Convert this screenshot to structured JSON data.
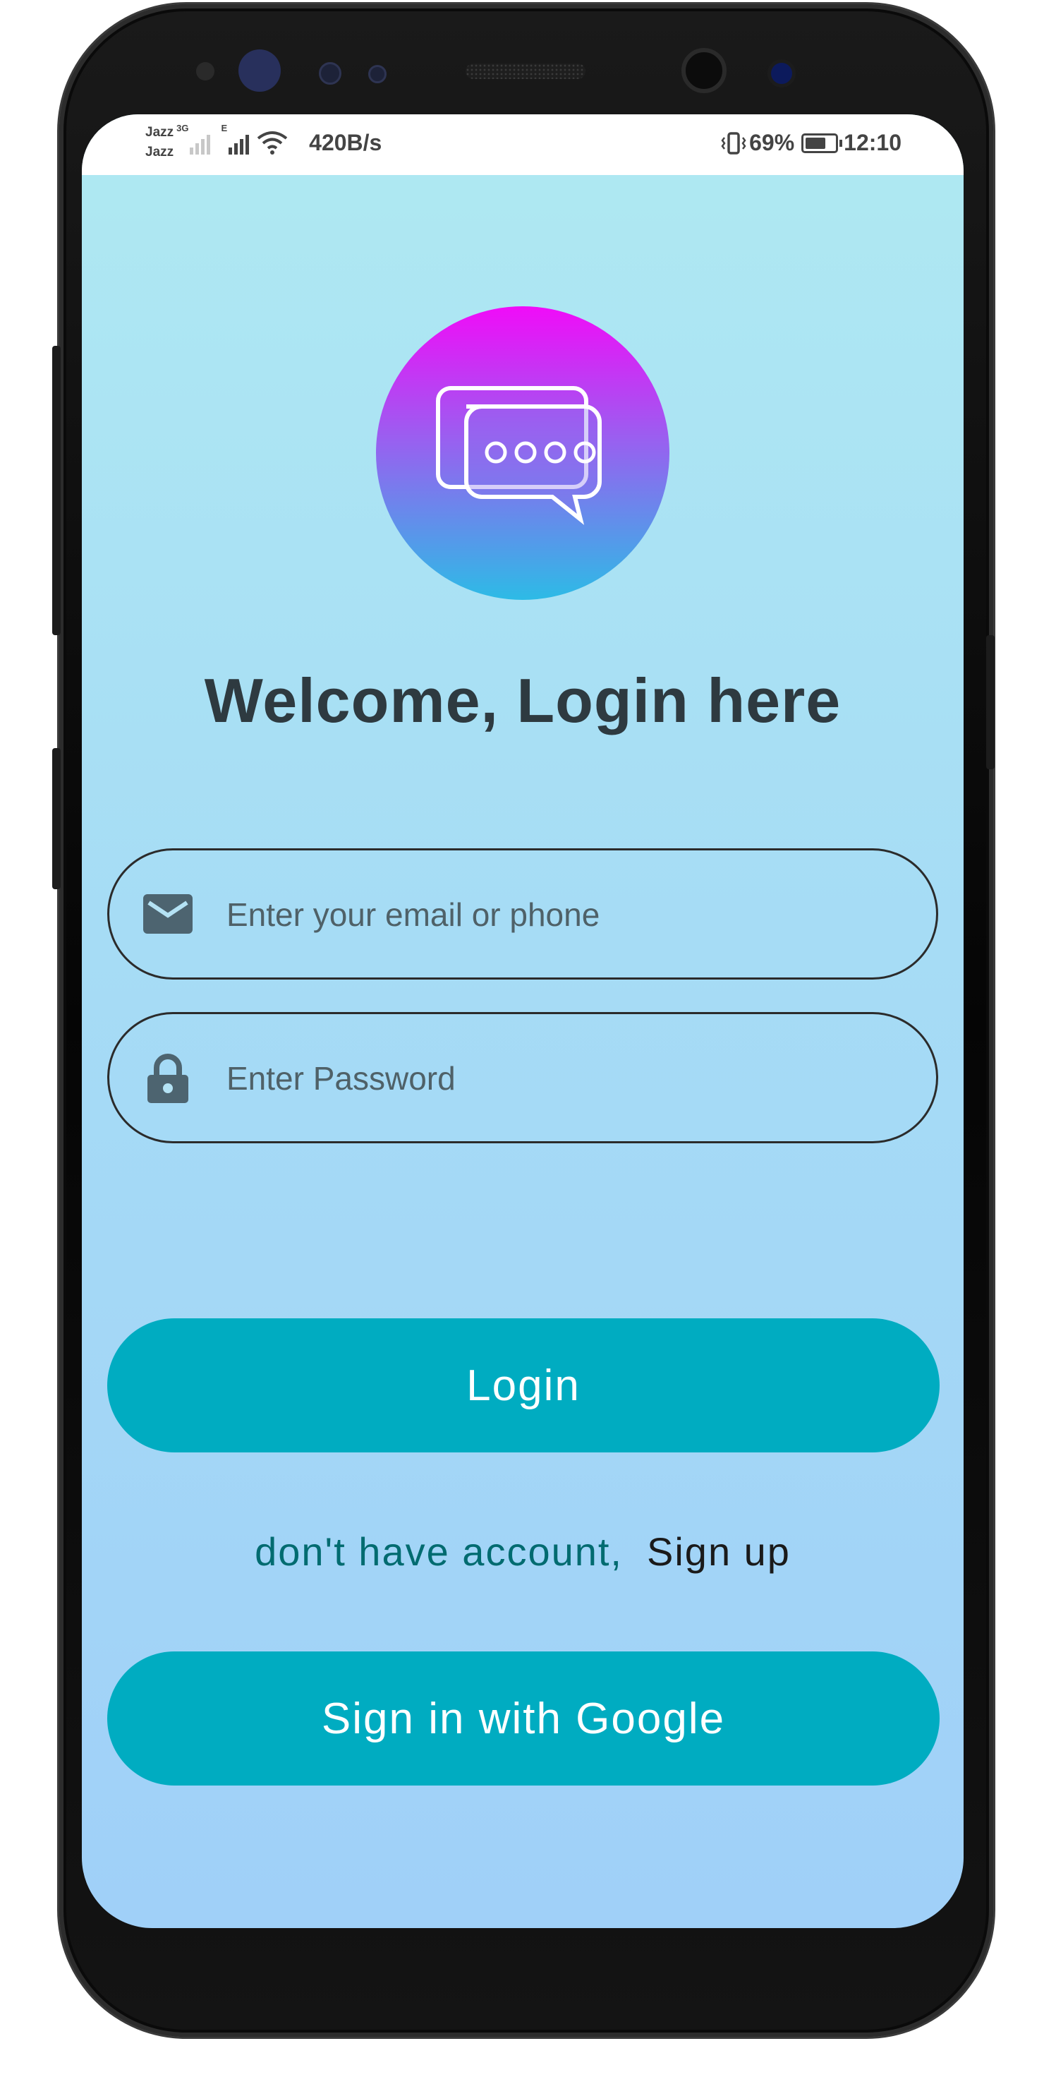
{
  "status_bar": {
    "carrier_1": "Jazz",
    "carrier_2": "Jazz",
    "network_tag_1": "3G",
    "network_tag_2": "E",
    "net_speed": "420B/s",
    "battery_percent": "69%",
    "battery_level": 0.69,
    "time": "12:10"
  },
  "login": {
    "title": "Welcome, Login here",
    "email": {
      "placeholder": "Enter your email or phone",
      "icon": "mail-icon"
    },
    "password": {
      "placeholder": "Enter Password",
      "icon": "lock-icon"
    },
    "login_button": "Login",
    "signup_prompt": "don't have account,",
    "signup_link": "Sign up",
    "google_button": "Sign in with Google"
  },
  "colors": {
    "accent": "#00acc1",
    "title": "#2e3a40",
    "signup_prompt": "#006b70",
    "logo_gradient_top": "#f00cf8",
    "logo_gradient_bottom": "#2dbbe6"
  }
}
